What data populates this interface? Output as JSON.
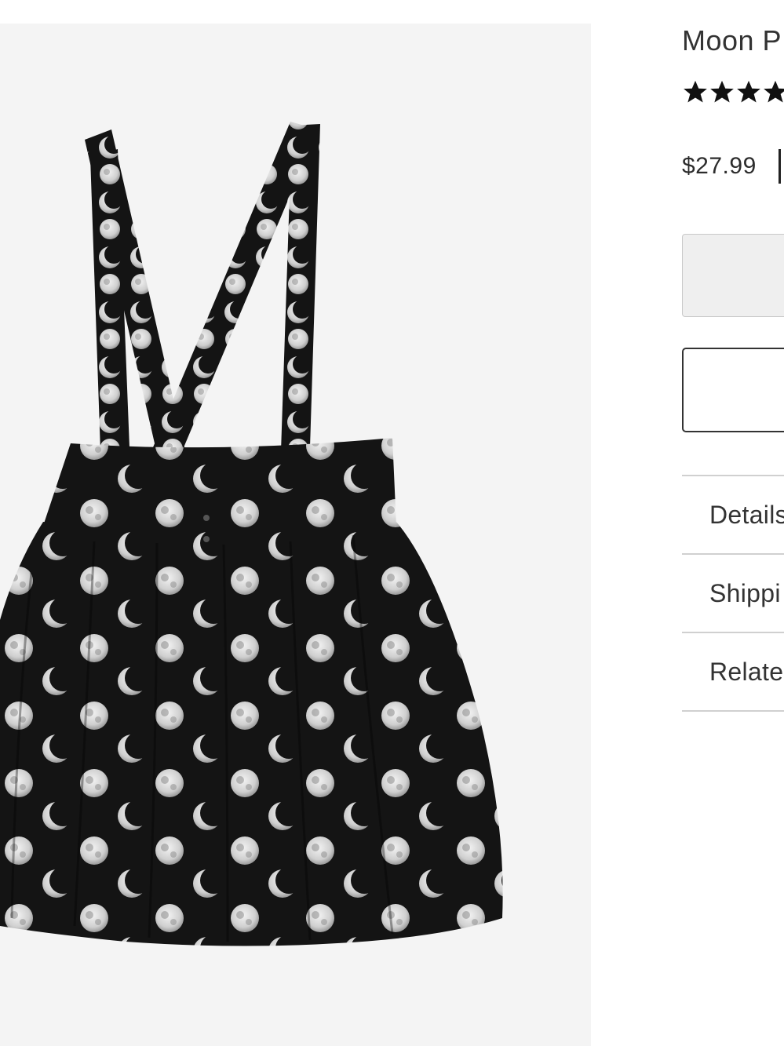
{
  "product": {
    "title": "Moon P",
    "rating_stars": 4,
    "price": "$27.99",
    "image_alt": "Moon print suspender skirt"
  },
  "buttons": {
    "primary_label": "",
    "secondary_label": ""
  },
  "accordion": {
    "items": [
      {
        "label": "Details"
      },
      {
        "label": "Shippi"
      },
      {
        "label": "Relate"
      }
    ]
  },
  "colors": {
    "gallery_background": "#f4f4f4",
    "skirt_fabric": "#141414",
    "moon_print": "#dcdcdc",
    "accent_text": "#222222"
  }
}
